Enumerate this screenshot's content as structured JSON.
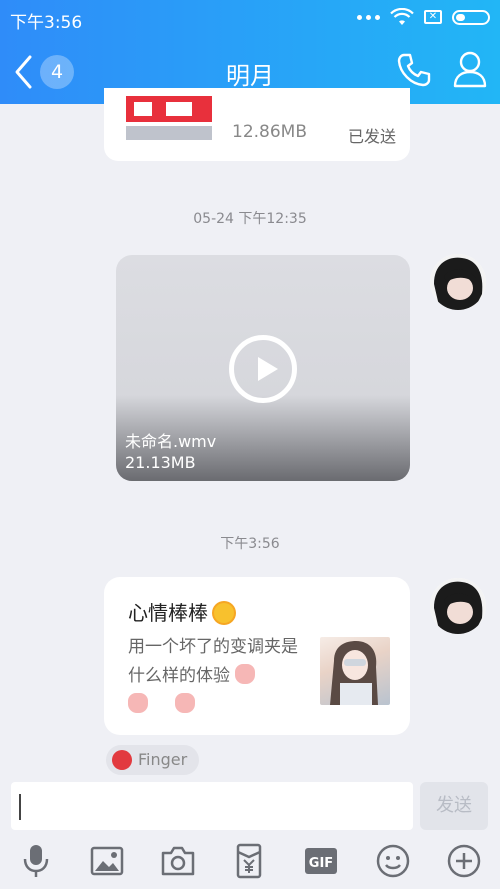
{
  "status_bar": {
    "time": "下午3:56"
  },
  "header": {
    "back_count": "4",
    "title": "明月"
  },
  "messages": {
    "prev_file": {
      "size": "12.86MB",
      "status": "已发送"
    },
    "timestamp1": "05-24 下午12:35",
    "video": {
      "name": "未命名.wmv",
      "size": "21.13MB"
    },
    "timestamp2": "下午3:56",
    "share": {
      "title": "心情棒棒",
      "desc": "用一个坏了的变调夹是什么样的体验",
      "source": "Finger"
    }
  },
  "input": {
    "value": "",
    "send_label": "发送"
  },
  "toolbar": {
    "items": [
      "mic-icon",
      "image-icon",
      "camera-icon",
      "redpacket-icon",
      "gif-icon",
      "emoji-icon",
      "plus-icon"
    ]
  },
  "colors": {
    "header_start": "#2f8cf9",
    "header_end": "#22b6f6",
    "background": "#eff0f5"
  }
}
